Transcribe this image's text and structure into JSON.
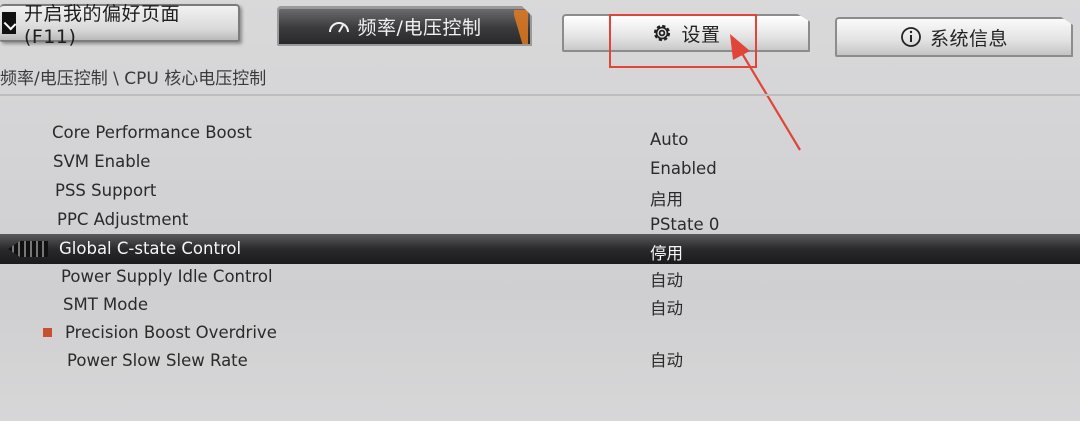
{
  "tabs": {
    "favorite": "开启我的偏好页面 (F11)",
    "freq_voltage": "频率/电压控制",
    "settings": "设置",
    "system_info": "系统信息"
  },
  "breadcrumb": "频率/电压控制 \\ CPU 核心电压控制",
  "colors": {
    "accent": "#e07a20",
    "highlight": "#e0453a",
    "bullet": "#c9502c"
  },
  "icons": {
    "favorite": "checkbox-icon",
    "freq": "gauge-icon",
    "settings": "gear-icon",
    "info": "info-icon"
  },
  "items": [
    {
      "label": "Core Performance Boost",
      "value": "Auto"
    },
    {
      "label": "SVM Enable",
      "value": "Enabled"
    },
    {
      "label": "PSS Support",
      "value": "启用"
    },
    {
      "label": "PPC Adjustment",
      "value": "PState 0"
    },
    {
      "label": "Global C-state Control",
      "value": "停用"
    },
    {
      "label": "Power Supply Idle Control",
      "value": "自动"
    },
    {
      "label": "SMT Mode",
      "value": "自动"
    },
    {
      "label": "Precision Boost Overdrive",
      "value": ""
    },
    {
      "label": "Power Slow Slew Rate",
      "value": "自动"
    }
  ]
}
